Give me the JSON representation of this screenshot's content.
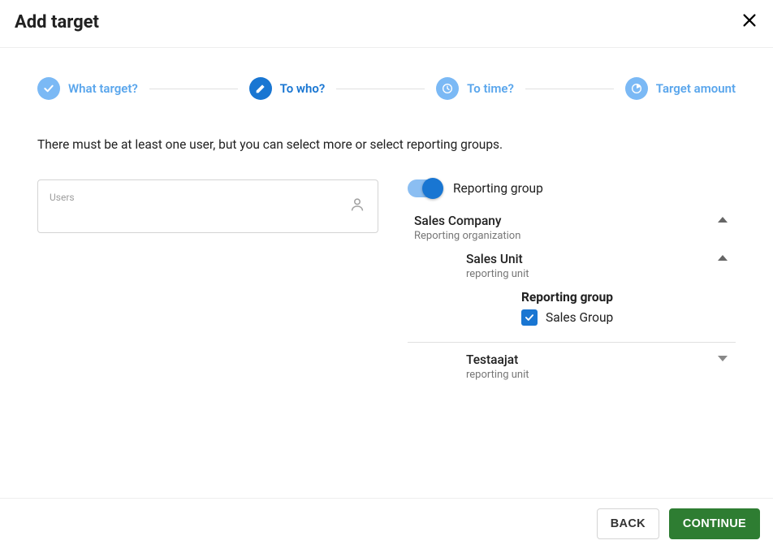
{
  "header": {
    "title": "Add target"
  },
  "stepper": {
    "steps": [
      {
        "label": "What target?"
      },
      {
        "label": "To who?"
      },
      {
        "label": "To time?"
      },
      {
        "label": "Target amount"
      }
    ]
  },
  "instruction": "There must be at least one user, but you can select more or select reporting groups.",
  "usersField": {
    "label": "Users"
  },
  "toggle": {
    "label": "Reporting group",
    "on": true
  },
  "tree": {
    "org": {
      "title": "Sales Company",
      "subtitle": "Reporting organization",
      "expanded": true
    },
    "unit1": {
      "title": "Sales Unit",
      "subtitle": "reporting unit",
      "expanded": true
    },
    "group_header": "Reporting group",
    "group_item": {
      "label": "Sales Group",
      "checked": true
    },
    "unit2": {
      "title": "Testaajat",
      "subtitle": "reporting unit",
      "expanded": false
    }
  },
  "footer": {
    "back": "BACK",
    "continue": "CONTINUE"
  },
  "colors": {
    "primary": "#1976d2",
    "primaryLight": "#7bb9f5",
    "success": "#2e7d32"
  }
}
